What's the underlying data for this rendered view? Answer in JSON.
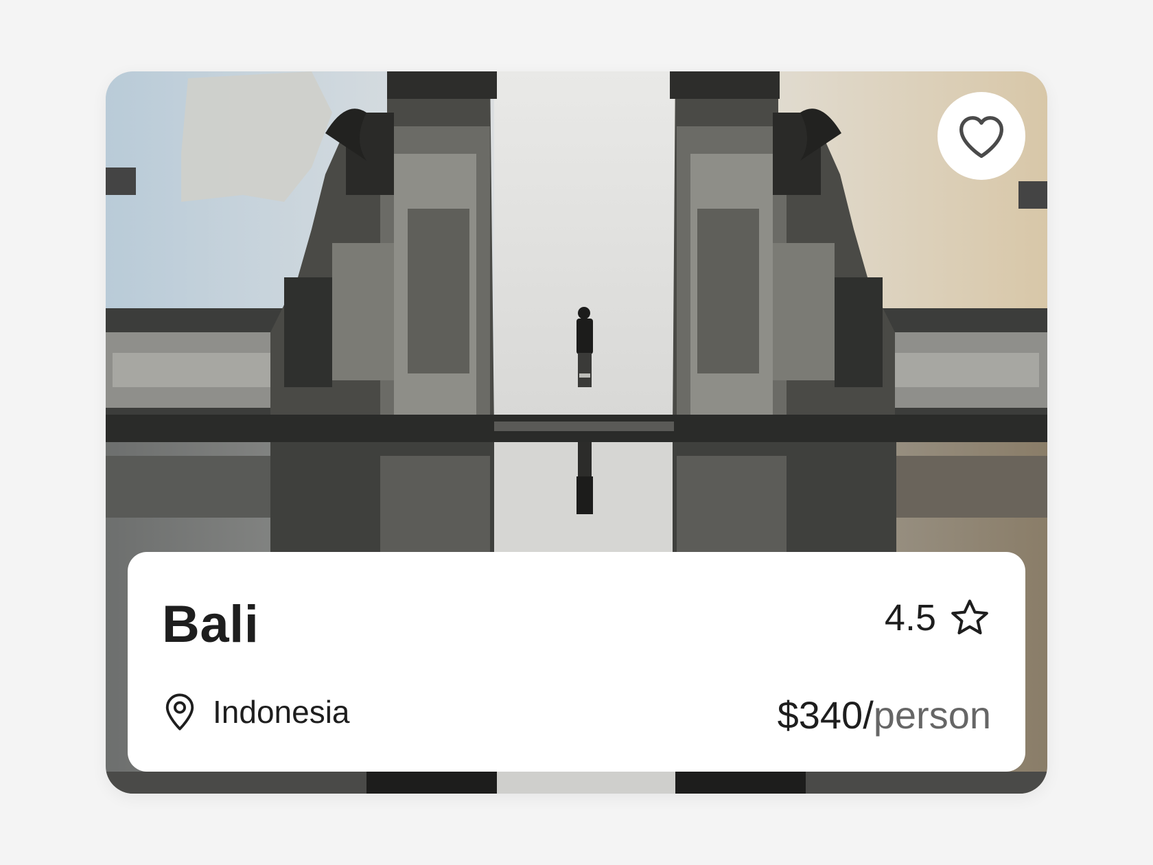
{
  "card": {
    "image_subject": "temple gates reflection",
    "favorite_icon": "heart-icon",
    "title": "Bali",
    "rating": {
      "value": "4.5",
      "icon": "star-icon"
    },
    "location": {
      "icon": "map-pin-icon",
      "label": "Indonesia"
    },
    "price": {
      "amount": "$340/",
      "unit": "person"
    }
  },
  "colors": {
    "page_background": "#f4f4f4",
    "text_primary": "#1e1e1e",
    "text_secondary": "#666666",
    "surface": "#ffffff"
  }
}
